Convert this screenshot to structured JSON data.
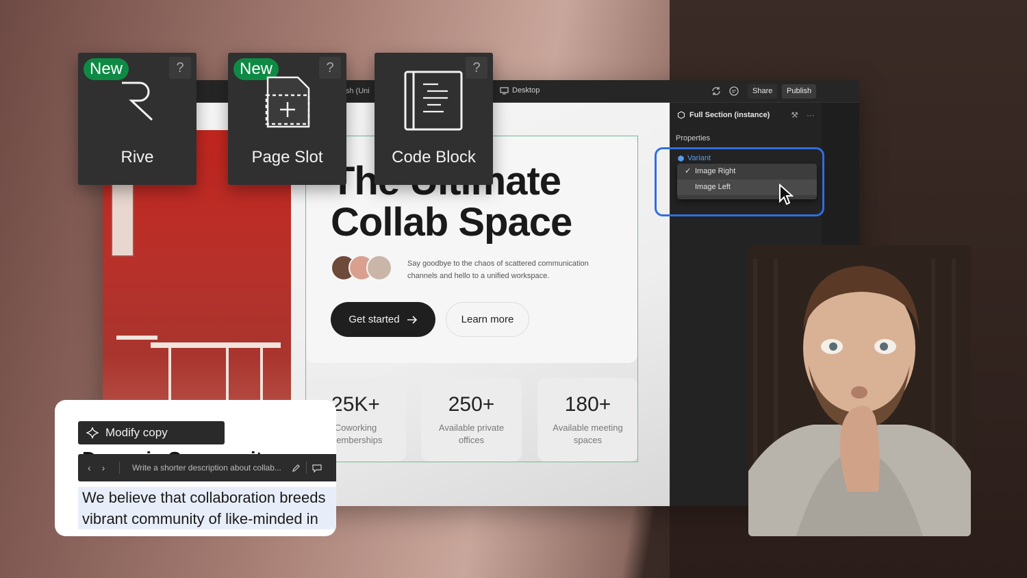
{
  "cards": [
    {
      "badge": "New",
      "help": "?",
      "name": "Rive",
      "icon": "rive-logo-icon"
    },
    {
      "badge": "New",
      "help": "?",
      "name": "Page Slot",
      "icon": "page-slot-icon"
    },
    {
      "badge": "",
      "help": "?",
      "name": "Code Block",
      "icon": "code-block-icon"
    }
  ],
  "topbar": {
    "locale": "lish (Uni",
    "device": "Desktop",
    "share": "Share",
    "publish": "Publish"
  },
  "hero": {
    "title_line1": "The Ultimate",
    "title_line2": "Collab Space",
    "description": "Say goodbye to the chaos of scattered communication channels and hello to a unified workspace.",
    "primary_button": "Get started",
    "secondary_button": "Learn more"
  },
  "stats": [
    {
      "value": "25K+",
      "label": "Coworking memberships"
    },
    {
      "value": "250+",
      "label": "Available private offices"
    },
    {
      "value": "180+",
      "label": "Available meeting spaces"
    }
  ],
  "panel": {
    "header": "Full Section (instance)",
    "properties": "Properties",
    "variant": "Variant",
    "options": [
      "Image Right",
      "Image Left"
    ],
    "selected": "Image Right"
  },
  "ai": {
    "modify": "Modify copy",
    "heading_behind": "Dynamic Community",
    "prompt": "Write a shorter description about collab...",
    "body_line1": "We believe that collaboration breeds",
    "body_line2": "vibrant community of like-minded in"
  },
  "colors": {
    "accent_green": "#0e8a44",
    "highlight_blue": "#2f6fe0",
    "variant_blue": "#5a9cf5"
  }
}
